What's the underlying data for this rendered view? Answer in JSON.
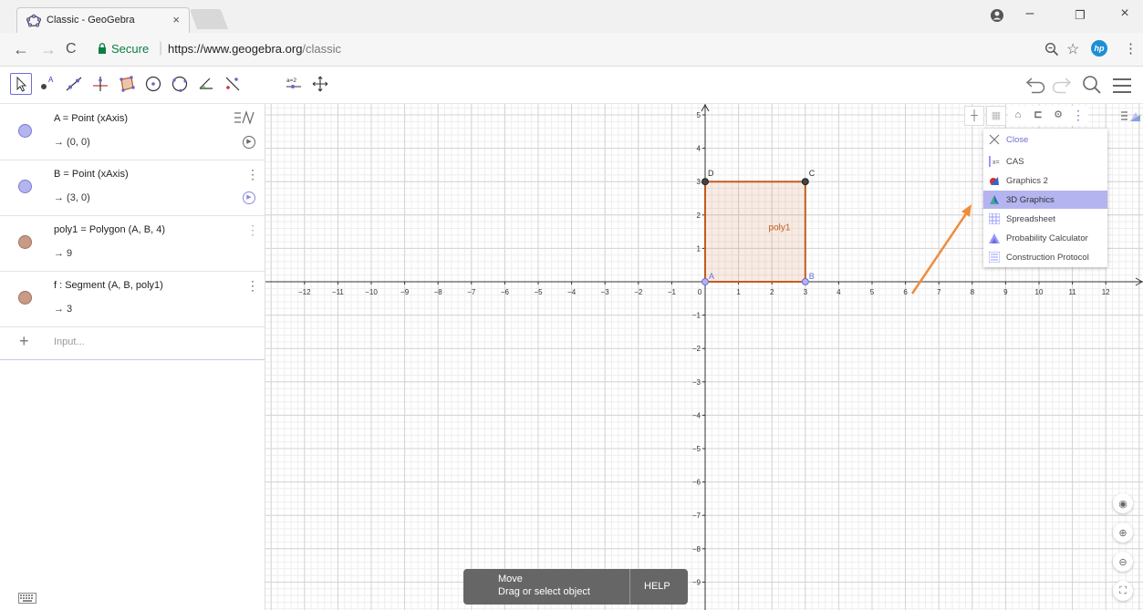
{
  "browser": {
    "tab_title": "Classic - GeoGebra",
    "tab_close": "×",
    "secure_label": "Secure",
    "url_host": "https://www.geogebra.org",
    "url_path": "/classic",
    "window_controls": [
      "–",
      "❐",
      "×"
    ]
  },
  "toolbar": {
    "tools": [
      "move-tool",
      "point-tool",
      "line-tool",
      "perpendicular-tool",
      "polygon-tool",
      "circle-center-tool",
      "circle-three-points-tool",
      "angle-tool",
      "reflect-tool",
      "slider-tool",
      "move-graphics-tool"
    ],
    "slider_label": "a=2"
  },
  "algebra": {
    "rows": [
      {
        "definition": "A = Point (xAxis)",
        "value": "→  (0, 0)",
        "color": "#b4b4f0"
      },
      {
        "definition": "B = Point (xAxis)",
        "value": "→  (3, 0)",
        "color": "#b4b4f0"
      },
      {
        "definition": "poly1 = Polygon (A, B, 4)",
        "value": "→  9",
        "color": "#c89b87"
      },
      {
        "definition": "f : Segment (A, B, poly1)",
        "value": "→  3",
        "color": "#c89b87"
      }
    ],
    "input_placeholder": "Input..."
  },
  "graphics": {
    "x_ticks": [
      "−12",
      "−11",
      "−10",
      "−9",
      "−8",
      "−7",
      "−6",
      "−5",
      "−4",
      "−3",
      "−2",
      "−1",
      "0",
      "1",
      "2",
      "3",
      "4",
      "5",
      "6",
      "7",
      "8",
      "9",
      "10",
      "11",
      "12"
    ],
    "y_ticks_pos": [
      "5",
      "4",
      "3",
      "2",
      "1"
    ],
    "y_ticks_neg": [
      "−1",
      "−2",
      "−3",
      "−4",
      "−5",
      "−6",
      "−7",
      "−8",
      "−9"
    ],
    "point_labels": [
      "A",
      "B",
      "C",
      "D"
    ],
    "polygon_label": "poly1",
    "polygon_color": "#c25b1e"
  },
  "view_menu": {
    "items": [
      {
        "label": "Close",
        "icon": "close-icon"
      },
      {
        "label": "CAS",
        "icon": "cas-icon"
      },
      {
        "label": "Graphics 2",
        "icon": "graphics2-icon"
      },
      {
        "label": "3D Graphics",
        "icon": "graphics3d-icon",
        "highlighted": true
      },
      {
        "label": "Spreadsheet",
        "icon": "spreadsheet-icon"
      },
      {
        "label": "Probability Calculator",
        "icon": "probability-icon"
      },
      {
        "label": "Construction Protocol",
        "icon": "protocol-icon"
      }
    ]
  },
  "status_bar": {
    "mode": "Move",
    "hint": "Drag or select object",
    "help": "HELP"
  },
  "colors": {
    "accent": "#6e6dd5",
    "annotation_arrow": "#f08c3c"
  }
}
